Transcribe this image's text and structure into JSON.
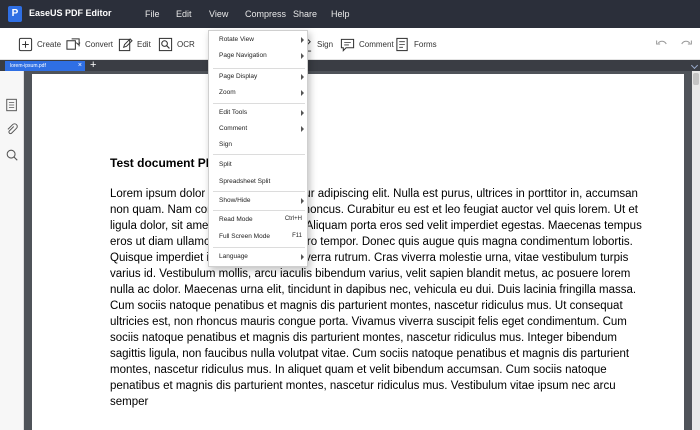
{
  "app": {
    "title": "EaseUS PDF Editor",
    "logo": "P"
  },
  "menubar": [
    "File",
    "Edit",
    "View",
    "Compress",
    "Share",
    "Help"
  ],
  "toolbar": {
    "create": "Create",
    "convert": "Convert",
    "edit": "Edit",
    "ocr": "OCR",
    "sign": "Sign",
    "comment": "Comment",
    "forms": "Forms"
  },
  "tabs": {
    "active": "lorem-ipsum.pdf",
    "close": "×",
    "new": "+"
  },
  "view_menu": {
    "rotate_view": "Rotate View",
    "page_navigation": "Page Navigation",
    "page_display": "Page Display",
    "zoom": "Zoom",
    "edit_tools": "Edit Tools",
    "comment": "Comment",
    "sign": "Sign",
    "split": "Split",
    "spreadsheet_split": "Spreadsheet Split",
    "show_hide": "Show/Hide",
    "read_mode": "Read Mode",
    "read_mode_shortcut": "Ctrl+H",
    "full_screen_mode": "Full Screen Mode",
    "full_screen_shortcut": "F11",
    "language": "Language"
  },
  "document": {
    "title": "Test document PDF",
    "body": "Lorem ipsum dolor sit amet, consectetur adipiscing elit. Nulla est purus, ultrices in porttitor in, accumsan non quam. Nam consectetur porttitor rhoncus. Curabitur eu est et leo feugiat auctor vel quis lorem. Ut et ligula dolor, sit amet consequat lorem. Aliquam porta eros sed velit imperdiet egestas. Maecenas tempus eros ut diam ullamcorper id dictum libero tempor. Donec quis augue quis magna condimentum lobortis. Quisque imperdiet ipsum vel magna viverra rutrum. Cras viverra molestie urna, vitae vestibulum turpis varius id. Vestibulum mollis, arcu iaculis bibendum varius, velit sapien blandit metus, ac posuere lorem nulla ac dolor. Maecenas urna elit, tincidunt in dapibus nec, vehicula eu dui. Duis lacinia fringilla massa. Cum sociis natoque penatibus et magnis dis parturient montes, nascetur ridiculus mus. Ut consequat ultricies est, non rhoncus mauris congue porta. Vivamus viverra suscipit felis eget condimentum. Cum sociis natoque penatibus et magnis dis parturient montes, nascetur ridiculus mus. Integer bibendum sagittis ligula, non faucibus nulla volutpat vitae. Cum sociis natoque penatibus et magnis dis parturient montes, nascetur ridiculus mus. In aliquet quam et velit bibendum accumsan. Cum sociis natoque penatibus et magnis dis parturient montes, nascetur ridiculus mus. Vestibulum vitae ipsum nec arcu semper"
  },
  "colors": {
    "titlebar": "#2b2f3a",
    "accent": "#2f6fe4",
    "canvas": "#4f5359"
  },
  "icons": {
    "toolbar": [
      "plus-icon",
      "convert-icon",
      "edit-icon",
      "ocr-icon",
      "sign-icon",
      "comment-icon",
      "forms-icon",
      "undo-icon",
      "redo-icon"
    ],
    "rail": [
      "thumbnails-icon",
      "attachment-icon",
      "search-icon"
    ]
  }
}
